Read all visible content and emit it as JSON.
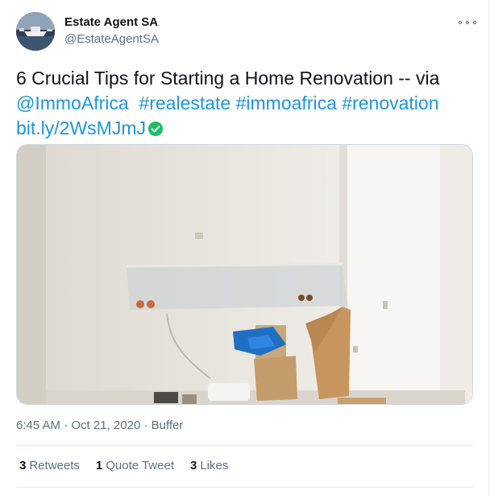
{
  "author": {
    "display_name": "Estate Agent SA",
    "handle": "@EstateAgentSA",
    "avatar_icon": "boat-harbor-avatar"
  },
  "tweet": {
    "text_line1": "6 Crucial Tips for Starting a Home Renovation -- via",
    "mention": "@ImmoAfrica",
    "hashtags": [
      "#realestate",
      "#immoafrica",
      "#renovation"
    ],
    "short_link": "bit.ly/2WsMJmJ",
    "link_badge_icon": "green-check-icon",
    "media_alt": "renovation photo"
  },
  "meta": {
    "time": "6:45 AM",
    "separator": "·",
    "date": "Oct 21, 2020",
    "source": "Buffer"
  },
  "stats": {
    "retweets_count": "3",
    "retweets_label": "Retweets",
    "quote_count": "1",
    "quote_label": "Quote Tweet",
    "likes_count": "3",
    "likes_label": "Likes"
  },
  "colors": {
    "link": "#1b95e0",
    "secondary_text": "#5b7083",
    "verified": "#17bf63"
  }
}
